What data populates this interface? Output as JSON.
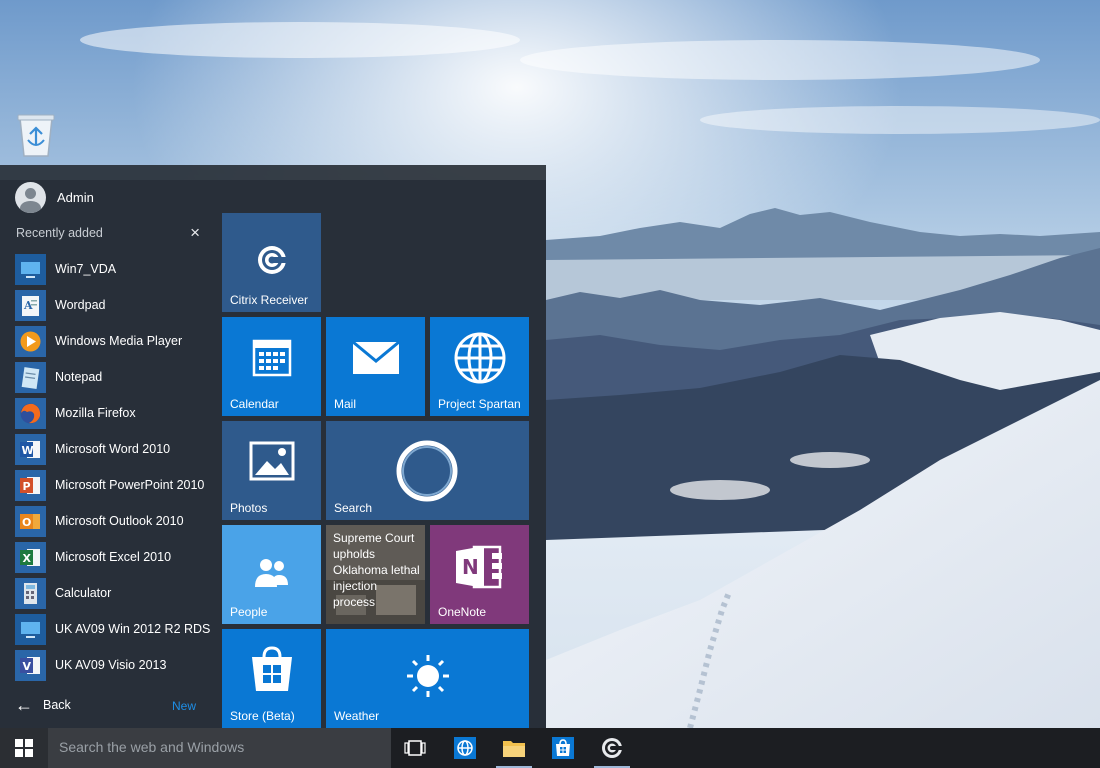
{
  "user": {
    "name": "Admin"
  },
  "recent": {
    "title": "Recently added",
    "close_icon": "×",
    "apps": [
      {
        "label": "Win7_VDA",
        "icon": "monitor-icon"
      },
      {
        "label": "Wordpad",
        "icon": "wordpad-icon"
      },
      {
        "label": "Windows Media Player",
        "icon": "media-player-icon"
      },
      {
        "label": "Notepad",
        "icon": "notepad-icon"
      },
      {
        "label": "Mozilla Firefox",
        "icon": "firefox-icon"
      },
      {
        "label": "Microsoft Word 2010",
        "icon": "word-icon"
      },
      {
        "label": "Microsoft PowerPoint 2010",
        "icon": "powerpoint-icon"
      },
      {
        "label": "Microsoft Outlook 2010",
        "icon": "outlook-icon"
      },
      {
        "label": "Microsoft Excel 2010",
        "icon": "excel-icon"
      },
      {
        "label": "Calculator",
        "icon": "calculator-icon"
      },
      {
        "label": "UK AV09 Win 2012 R2 RDS",
        "icon": "monitor-icon"
      },
      {
        "label": "UK AV09 Visio 2013",
        "icon": "visio-icon"
      }
    ]
  },
  "nav": {
    "back_label": "Back",
    "back_arrow": "←",
    "new_label": "New"
  },
  "tiles": {
    "citrix": "Citrix Receiver",
    "calendar": "Calendar",
    "mail": "Mail",
    "spartan": "Project Spartan",
    "photos": "Photos",
    "search": "Search",
    "news": "Supreme Court upholds Oklahoma lethal injection process",
    "people": "People",
    "onenote": "OneNote",
    "store": "Store (Beta)",
    "weather": "Weather"
  },
  "taskbar": {
    "search_placeholder": "Search the web and Windows"
  },
  "colors": {
    "tile_blue": "#0a78d4",
    "tile_slate": "#2f5a8c",
    "tile_light": "#4aa3e8",
    "tile_purple": "#80397b",
    "accent_new": "#1e8ee5"
  }
}
